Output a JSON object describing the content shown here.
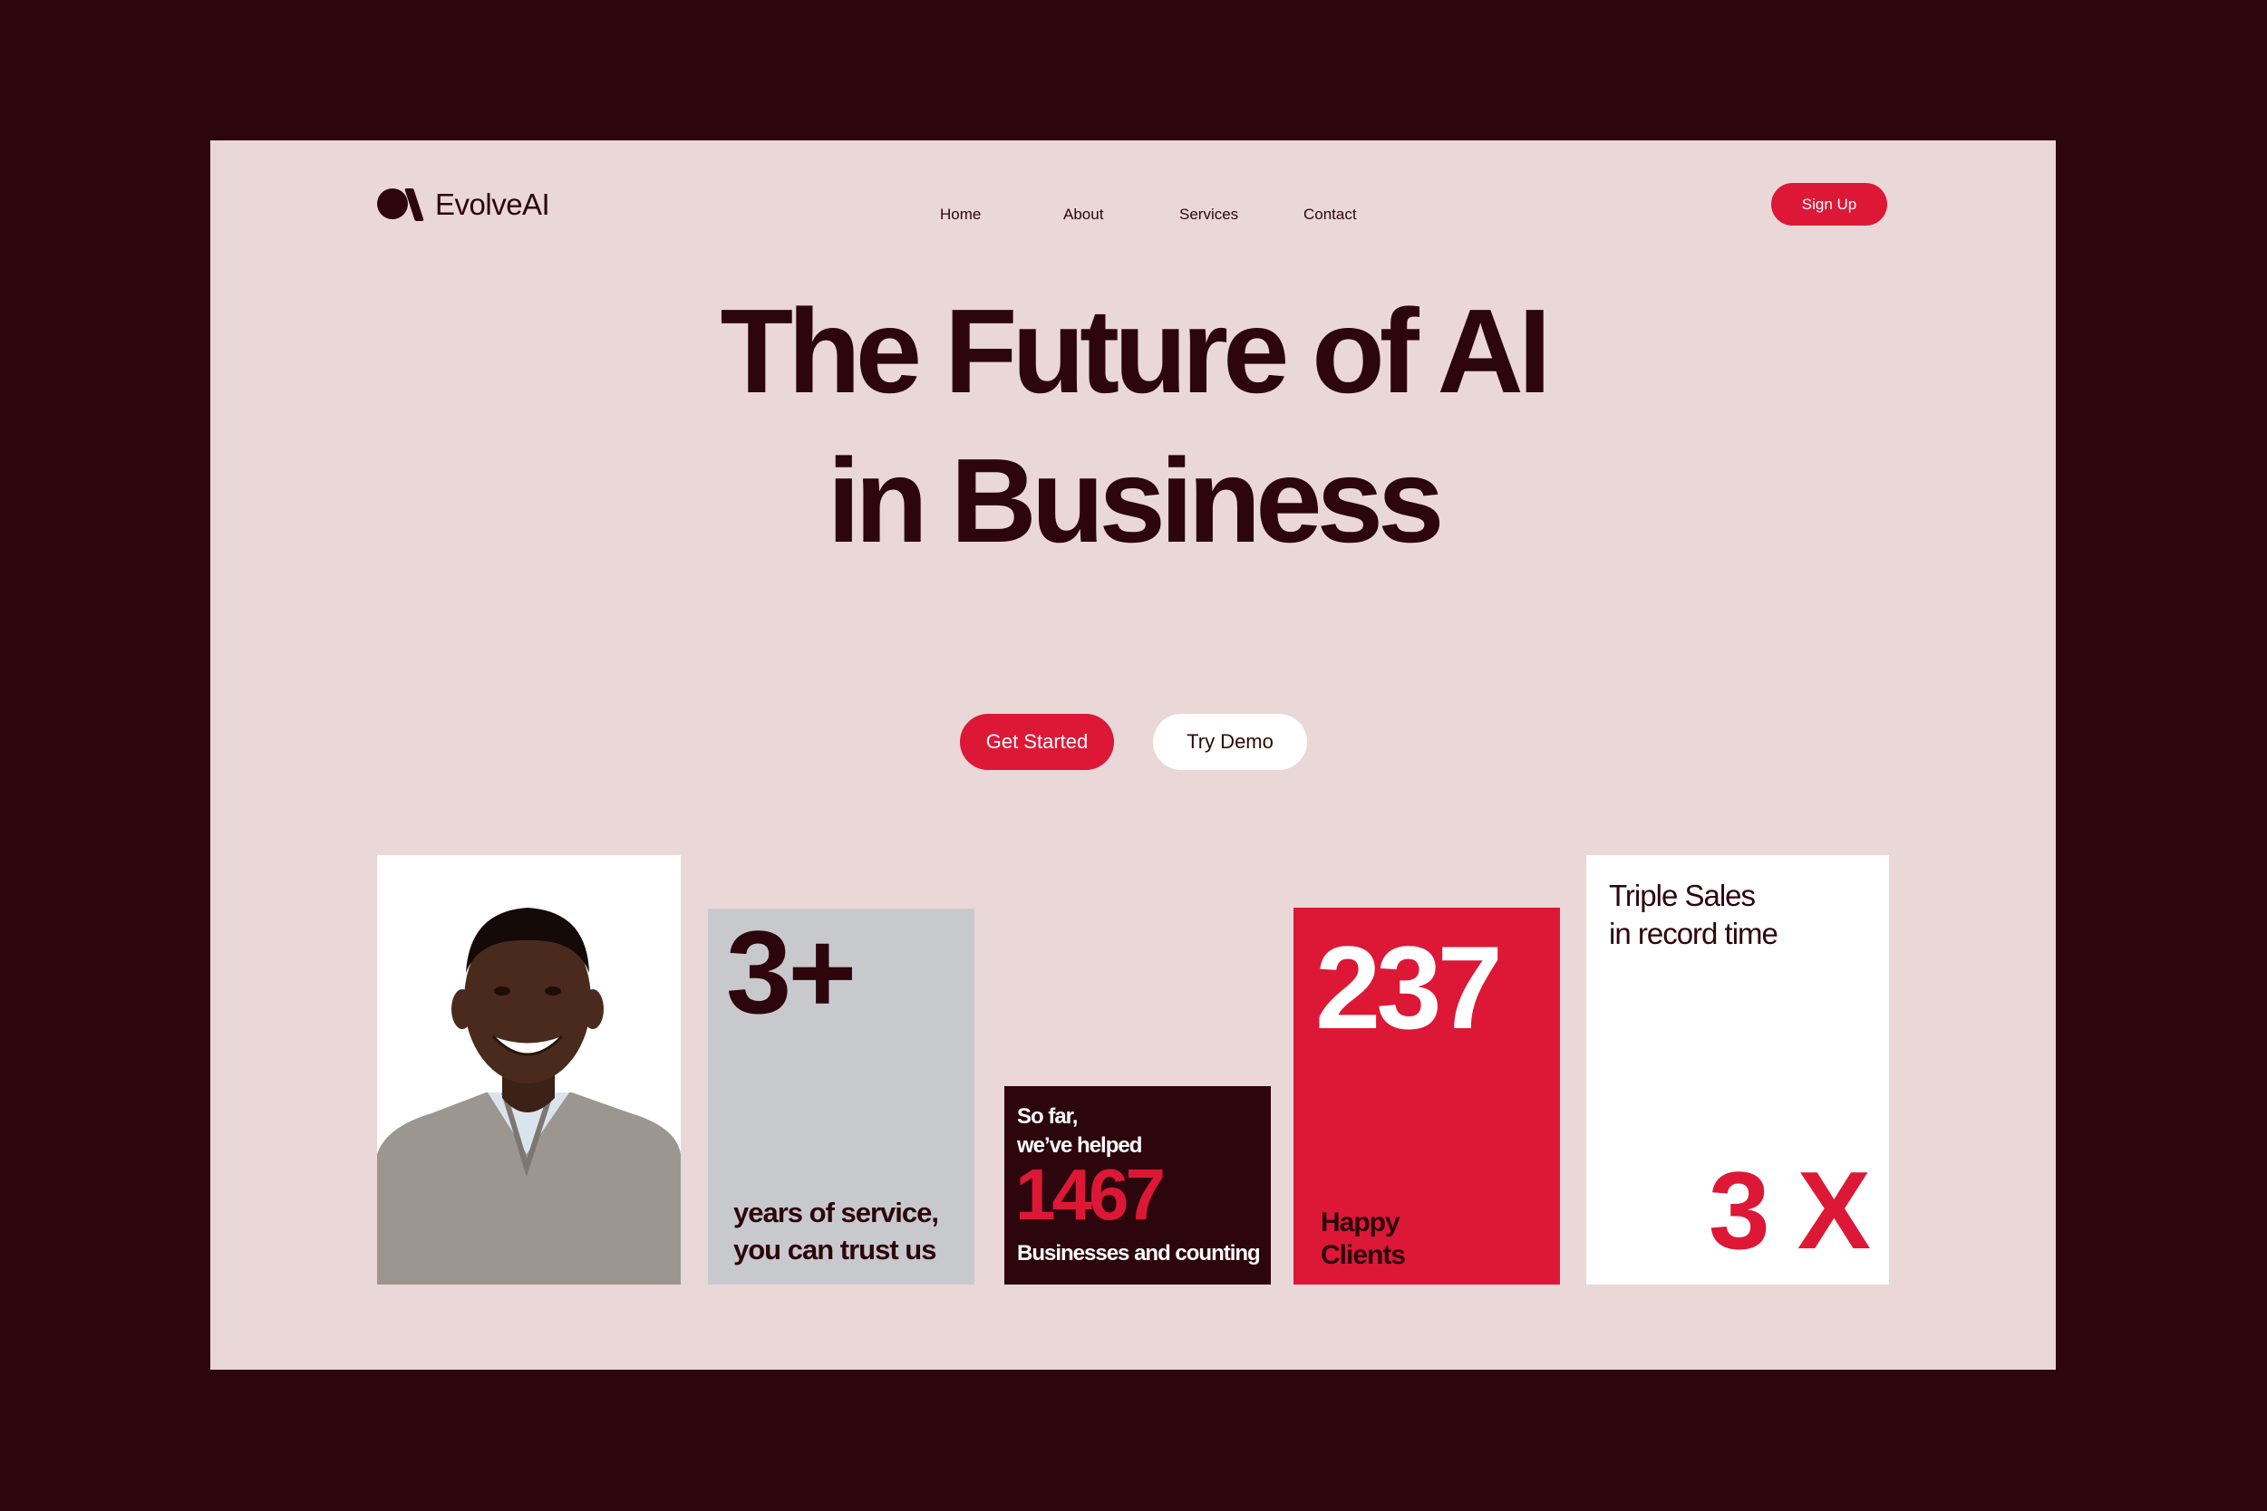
{
  "header": {
    "brand": "EvolveAI",
    "nav": [
      "Home",
      "About",
      "Services",
      "Contact"
    ],
    "signup_label": "Sign Up"
  },
  "hero": {
    "title_line1": "The Future of AI",
    "title_line2": "in Business",
    "primary_cta": "Get Started",
    "secondary_cta": "Try Demo"
  },
  "cards": {
    "photo": {
      "icon": "person-photo"
    },
    "years": {
      "value": "3+",
      "line1": "years of service,",
      "line2": "you can trust us"
    },
    "helped": {
      "line1": "So far,",
      "line2": "we’ve helped",
      "value": "1467",
      "caption": "Businesses and counting"
    },
    "clients": {
      "value": "237",
      "line1": "Happy",
      "line2": "Clients"
    },
    "triple": {
      "line1": "Triple Sales",
      "line2": "in record time",
      "value": "3 X"
    }
  },
  "colors": {
    "frame": "#2c060c",
    "page": "#ead7d8",
    "accent": "#dc1836",
    "card_gray": "#c8c9cd",
    "dark": "#2c060c",
    "white": "#ffffff"
  }
}
